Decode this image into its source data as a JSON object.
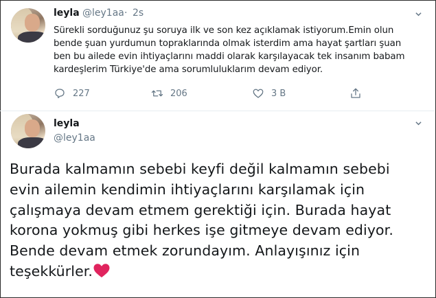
{
  "tweet1": {
    "name": "leyla",
    "handle": "@ley1aa",
    "separator": "·",
    "time": "2s",
    "text": "Sürekli sorduğunuz şu soruya ilk ve son kez açıklamak istiyorum.Emin olun\nbende şuan yurdumun topraklarında olmak isterdim ama hayat şartları şuan\nben bu ailede evin ihtiyaçlarını maddi olarak karşılayacak tek insanım babam\nkardeşlerim Türkiye'de ama sorumluluklarım devam ediyor.",
    "actions": {
      "reply_count": "227",
      "retweet_count": "206",
      "like_count": "3 B"
    }
  },
  "tweet2": {
    "name": "leyla",
    "handle": "@ley1aa",
    "text": "Burada kalmamın sebebi keyfi değil kalmamın sebebi\nevin ailemin kendimin ihtiyaçlarını karşılamak için\nçalışmaya devam etmem gerektiği için. Burada hayat\nkorona yokmuş gibi herkes işe gitmeye devam ediyor.\nBende devam etmek zorundayım.  Anlayışınız için\nteşekkürler."
  },
  "colors": {
    "text": "#14171a",
    "secondary": "#657786",
    "heart": "#e0245e"
  },
  "icons": [
    "avatar",
    "chevron-down-icon",
    "reply-icon",
    "retweet-icon",
    "like-icon",
    "share-icon",
    "red-heart-emoji"
  ]
}
